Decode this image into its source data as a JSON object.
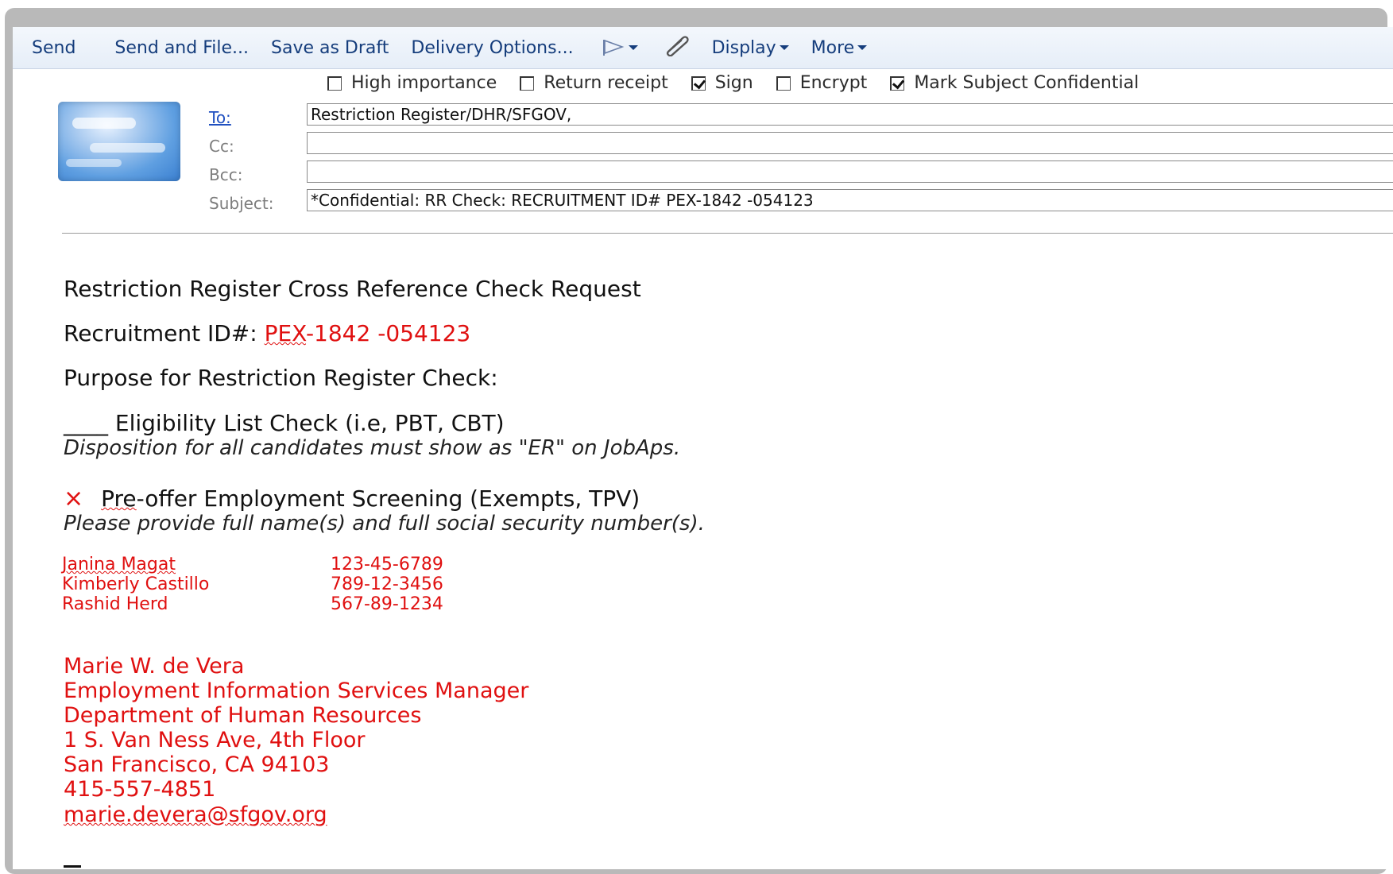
{
  "toolbar": {
    "send": "Send",
    "send_and_file": "Send and File...",
    "save_as_draft": "Save as Draft",
    "delivery_options": "Delivery Options...",
    "display": "Display",
    "more": "More"
  },
  "options": [
    {
      "label": "High importance",
      "checked": false
    },
    {
      "label": "Return receipt",
      "checked": false
    },
    {
      "label": "Sign",
      "checked": true
    },
    {
      "label": "Encrypt",
      "checked": false
    },
    {
      "label": "Mark Subject Confidential",
      "checked": true
    }
  ],
  "address": {
    "to_label": "To:",
    "cc_label": "Cc:",
    "bcc_label": "Bcc:",
    "subject_label": "Subject:",
    "to_value": "Restriction Register/DHR/SFGOV,",
    "cc_value": "",
    "bcc_value": "",
    "subject_value": "*Confidential: RR Check: RECRUITMENT ID#  PEX-1842 -054123"
  },
  "body": {
    "heading": "Restriction Register Cross Reference Check Request",
    "recruitment_label": "Recruitment ID#: ",
    "recruitment_id_prefix": "PEX",
    "recruitment_id_rest": "-1842 -054123",
    "purpose": "Purpose for Restriction Register Check:",
    "eligibility": "____ Eligibility List Check (i.e, PBT, CBT)",
    "eligibility_note": "Disposition for all candidates must show as \"ER\" on JobAps.",
    "preoffer_mark": "×",
    "preoffer_prefix": "Pre",
    "preoffer_rest": "-offer Employment Screening (Exempts, TPV)",
    "preoffer_note": "Please provide full name(s) and full social security number(s).",
    "candidates": [
      {
        "name": "Janina Magat",
        "ssn": "123-45-6789"
      },
      {
        "name": "Kimberly Castillo",
        "ssn": "789-12-3456"
      },
      {
        "name": "Rashid Herd",
        "ssn": "567-89-1234"
      }
    ],
    "signature": {
      "name": "Marie W. de Vera",
      "title": "Employment Information Services Manager",
      "department": "Department of Human Resources",
      "address1": "1 S. Van Ness Ave, 4th Floor",
      "address2": "San Francisco, CA 94103",
      "phone": "415-557-4851",
      "email": "marie.devera@sfgov.org"
    }
  }
}
